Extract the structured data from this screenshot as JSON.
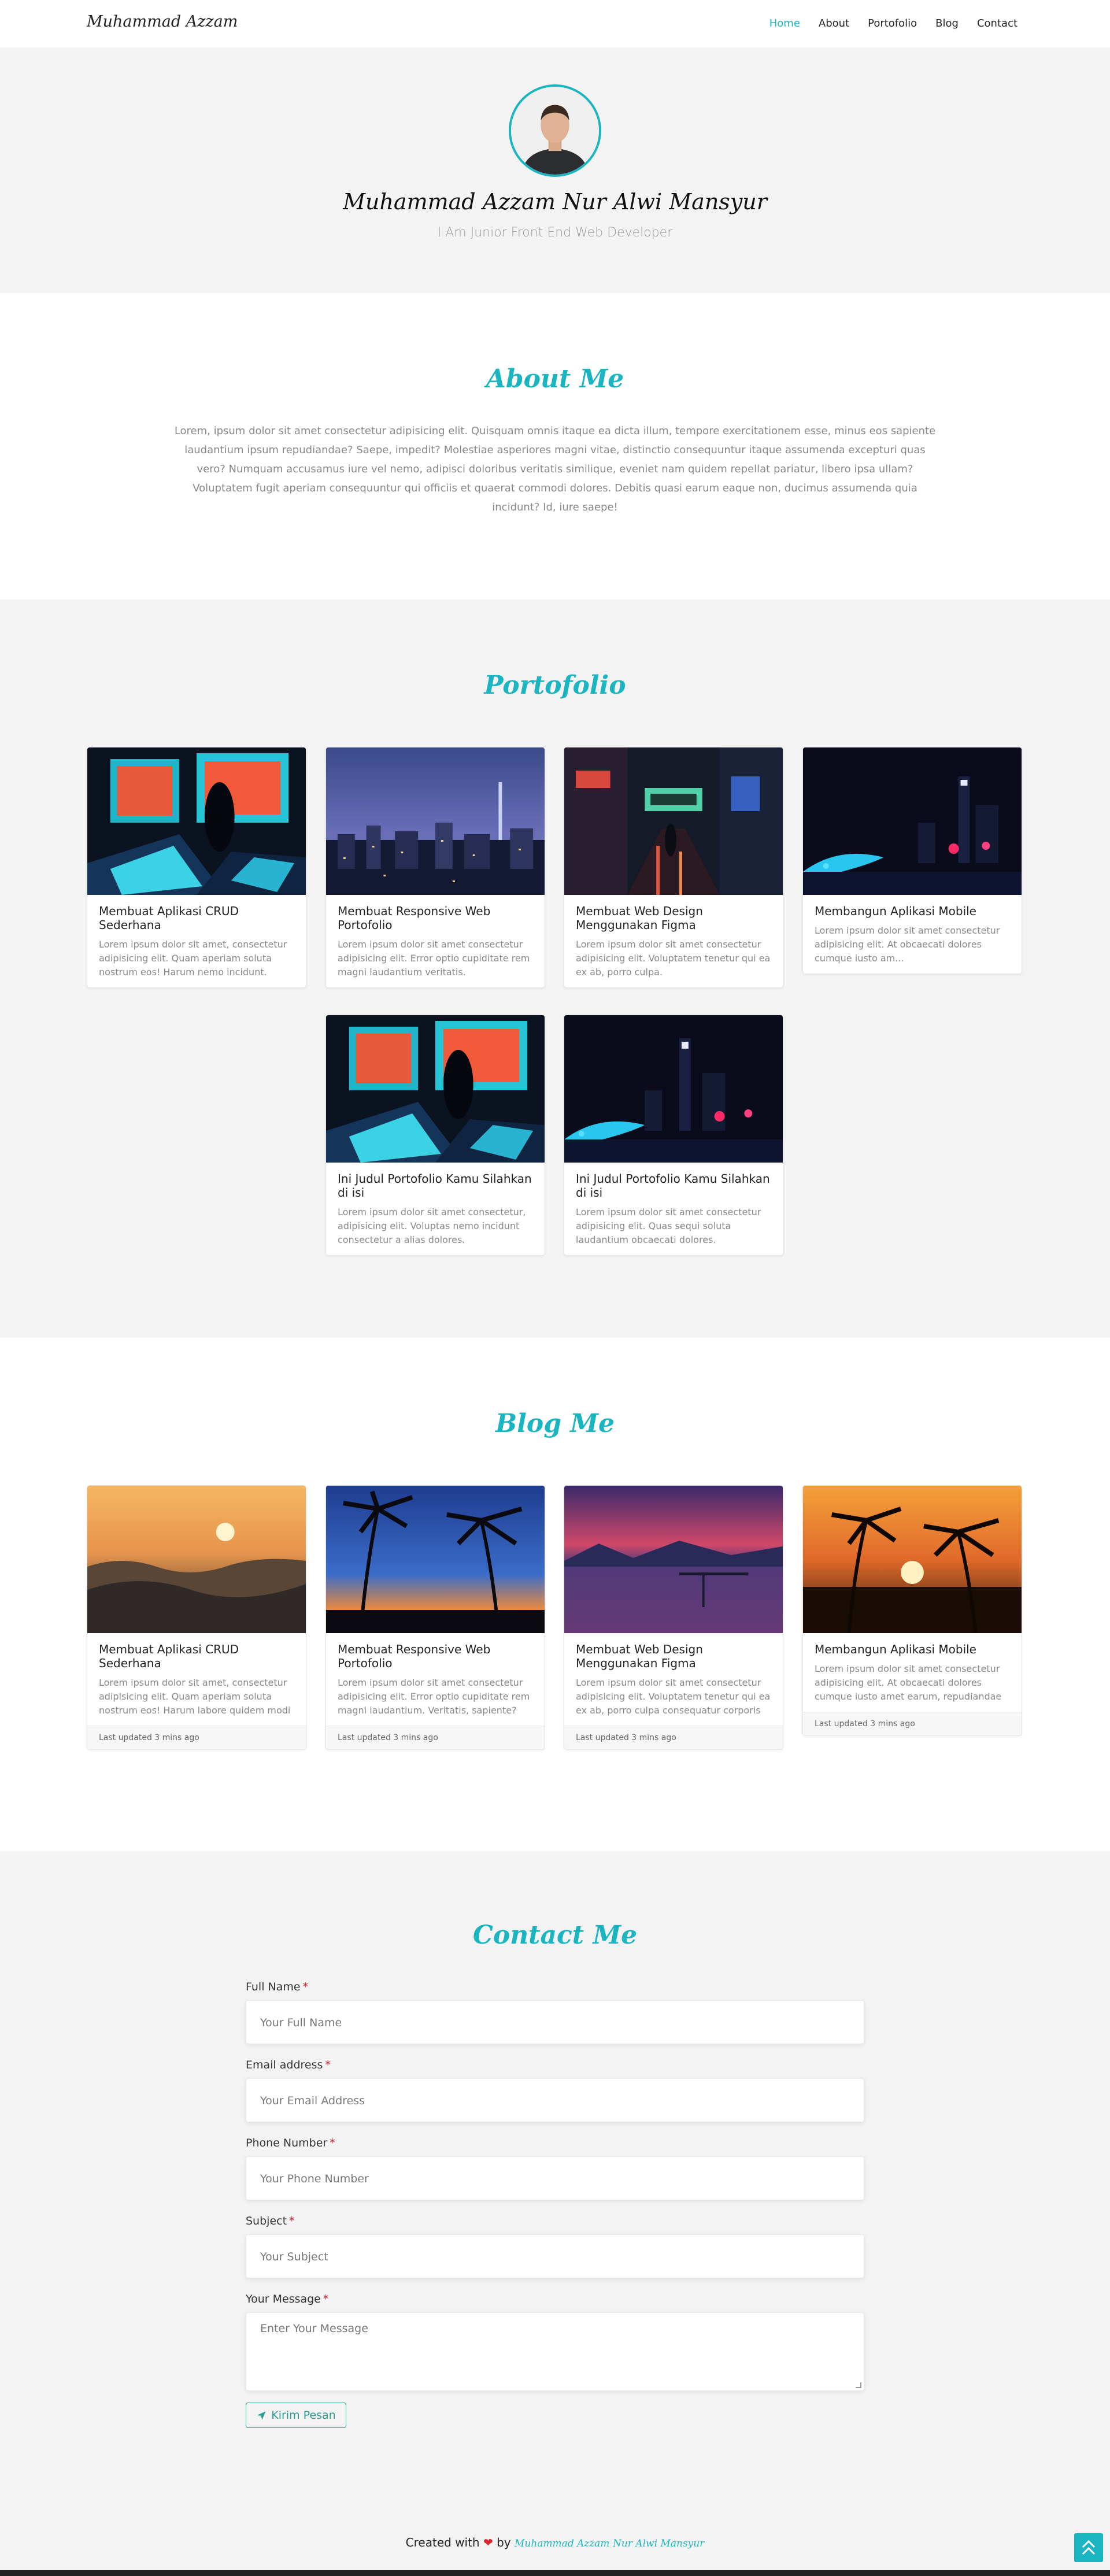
{
  "nav": {
    "brand": "Muhammad Azzam",
    "links": [
      "Home",
      "About",
      "Portofolio",
      "Blog",
      "Contact"
    ],
    "active": "Home"
  },
  "hero": {
    "name": "Muhammad Azzam Nur Alwi Mansyur",
    "tagline": "I Am Junior Front End Web Developer"
  },
  "about": {
    "title": "About Me",
    "text": "Lorem, ipsum dolor sit amet consectetur adipisicing elit. Quisquam omnis itaque ea dicta illum, tempore exercitationem esse, minus eos sapiente laudantium ipsum repudiandae? Saepe, impedit? Molestiae asperiores magni vitae, distinctio consequuntur itaque assumenda excepturi quas vero? Numquam accusamus iure vel nemo, adipisci doloribus veritatis similique, eveniet nam quidem repellat pariatur, libero ipsa ullam? Voluptatem fugit aperiam consequuntur qui officiis et quaerat commodi dolores. Debitis quasi earum eaque non, ducimus assumenda quia incidunt? Id, iure saepe!"
  },
  "portfolio": {
    "title": "Portofolio",
    "items": [
      {
        "title": "Membuat Aplikasi CRUD Sederhana",
        "text": "Lorem ipsum dolor sit amet, consectetur adipisicing elit. Quam aperiam soluta nostrum eos! Harum nemo incidunt.",
        "image": "arcade-machines"
      },
      {
        "title": "Membuat Responsive Web Portofolio",
        "text": "Lorem ipsum dolor sit amet consectetur adipisicing elit. Error optio cupiditate rem magni laudantium veritatis.",
        "image": "city-skyline-night"
      },
      {
        "title": "Membuat Web Design Menggunakan Figma",
        "text": "Lorem ipsum dolor sit amet consectetur adipisicing elit. Voluptatem tenetur qui ea ex ab, porro culpa.",
        "image": "neon-street"
      },
      {
        "title": "Membangun Aplikasi Mobile",
        "text": "Lorem ipsum dolor sit amet consectetur adipisicing elit. At obcaecati dolores cumque iusto am...",
        "image": "neon-city-night"
      },
      {
        "title": "Ini Judul Portofolio Kamu Silahkan di isi",
        "text": "Lorem ipsum dolor sit amet consectetur, adipisicing elit. Voluptas nemo incidunt consectetur a alias dolores.",
        "image": "arcade-machines"
      },
      {
        "title": "Ini Judul Portofolio Kamu Silahkan di isi",
        "text": "Lorem ipsum dolor sit amet consectetur adipisicing elit. Quas sequi soluta laudantium obcaecati dolores.",
        "image": "neon-city-night"
      }
    ]
  },
  "blog": {
    "title": "Blog Me",
    "items": [
      {
        "title": "Membuat Aplikasi CRUD Sederhana",
        "text": "Lorem ipsum dolor sit amet, consectetur adipisicing elit. Quam aperiam soluta nostrum eos! Harum labore quidem modi dolorum impedit.",
        "updated": "Last updated 3 mins ago",
        "image": "ocean-sunset"
      },
      {
        "title": "Membuat Responsive Web Portofolio",
        "text": "Lorem ipsum dolor sit amet consectetur adipisicing elit. Error optio cupiditate rem magni laudantium. Veritatis, sapiente? Dignissimos ut.",
        "updated": "Last updated 3 mins ago",
        "image": "palm-trees-dusk"
      },
      {
        "title": "Membuat Web Design Menggunakan Figma",
        "text": "Lorem ipsum dolor sit amet consectetur adipisicing elit. Voluptatem tenetur qui ea ex ab, porro culpa consequatur corporis veniam?",
        "updated": "Last updated 3 mins ago",
        "image": "lake-sunset"
      },
      {
        "title": "Membangun Aplikasi Mobile",
        "text": "Lorem ipsum dolor sit amet consectetur adipisicing elit. At obcaecati dolores cumque iusto amet earum, repudiandae modi rerum optio.",
        "updated": "Last updated 3 mins ago",
        "image": "palm-sunset-beach"
      }
    ]
  },
  "contact": {
    "title": "Contact Me",
    "fields": [
      {
        "label": "Full Name",
        "required": "*",
        "placeholder": "Your Full Name"
      },
      {
        "label": "Email address",
        "required": "*",
        "placeholder": "Your Email Address"
      },
      {
        "label": "Phone Number",
        "required": "*",
        "placeholder": "Your Phone Number"
      },
      {
        "label": "Subject",
        "required": "*",
        "placeholder": "Your Subject"
      },
      {
        "label": "Your Message",
        "required": "*",
        "placeholder": "Enter Your Message"
      }
    ],
    "submit": "Kirim Pesan"
  },
  "footer": {
    "created": "Created with",
    "heart": "❤",
    "by": "by",
    "author": "Muhammad Azzam Nur Alwi Mansyur"
  },
  "colors": {
    "accent": "#1ab5c0",
    "submit": "#2a9d8f",
    "heart": "#d9232d"
  }
}
